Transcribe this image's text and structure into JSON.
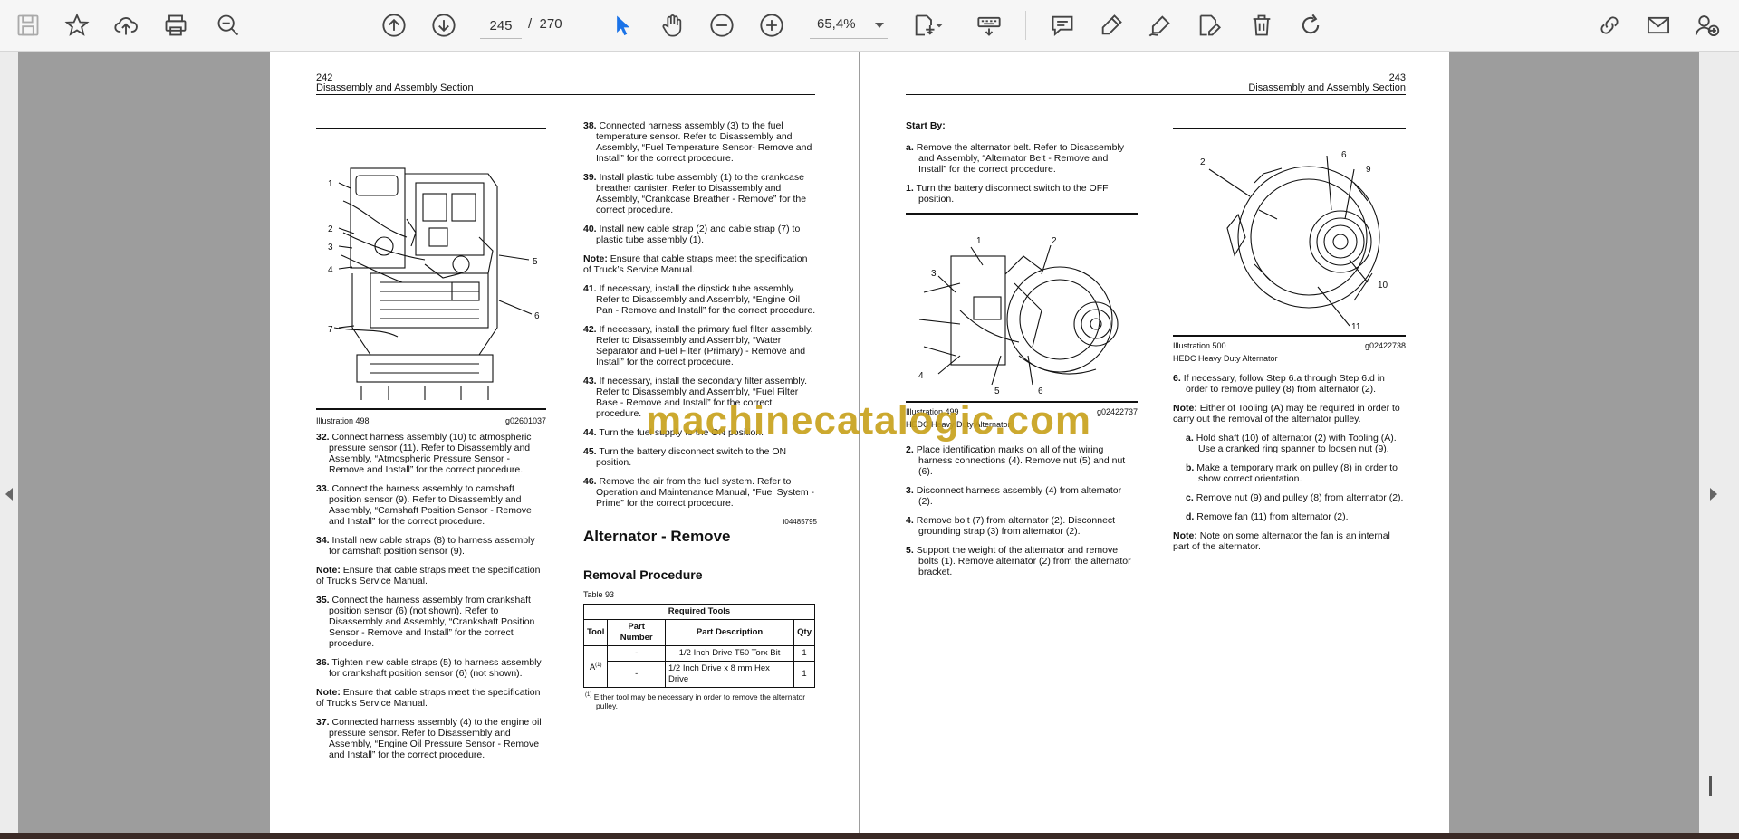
{
  "toolbar": {
    "page_current": "245",
    "page_separator": "/",
    "page_total": "270",
    "zoom": "65,4%"
  },
  "left_page": {
    "page_number": "242",
    "section": "Disassembly and Assembly Section",
    "illustration_label": "Illustration 498",
    "illustration_code": "g02601037",
    "callouts": [
      "1",
      "2",
      "3",
      "4",
      "5",
      "6",
      "7"
    ],
    "col1_steps": [
      {
        "num": "32.",
        "text": "Connect harness assembly (10) to atmospheric pressure sensor (11). Refer to Disassembly and Assembly, “Atmospheric Pressure Sensor - Remove and Install” for the correct procedure."
      },
      {
        "num": "33.",
        "text": "Connect the harness assembly to camshaft position sensor (9). Refer to Disassembly and Assembly, “Camshaft Position Sensor - Remove and Install” for the correct procedure."
      },
      {
        "num": "34.",
        "text": "Install new cable straps (8) to harness assembly for camshaft position sensor (9)."
      }
    ],
    "note1_label": "Note:",
    "note1_text": "Ensure that cable straps meet the specification of Truck’s Service Manual.",
    "col1_steps_b": [
      {
        "num": "35.",
        "text": "Connect the harness assembly from crankshaft position sensor (6) (not shown). Refer to Disassembly and Assembly, “Crankshaft Position Sensor - Remove and Install” for the correct procedure."
      },
      {
        "num": "36.",
        "text": "Tighten new cable straps (5) to harness assembly for crankshaft position sensor (6) (not shown)."
      }
    ],
    "note2_label": "Note:",
    "note2_text": "Ensure that cable straps meet the specification of Truck’s Service Manual.",
    "col1_steps_c": [
      {
        "num": "37.",
        "text": "Connected harness assembly (4) to the engine oil pressure sensor. Refer to Disassembly and Assembly, “Engine Oil Pressure Sensor - Remove and Install” for the correct procedure."
      }
    ],
    "col2_steps": [
      {
        "num": "38.",
        "text": "Connected harness assembly (3) to the fuel temperature sensor. Refer to Disassembly and Assembly, “Fuel Temperature Sensor- Remove and Install” for the correct procedure."
      },
      {
        "num": "39.",
        "text": "Install plastic tube assembly (1) to the crankcase breather canister. Refer to Disassembly and Assembly, “Crankcase Breather - Remove” for the correct procedure."
      },
      {
        "num": "40.",
        "text": "Install new cable strap (2) and cable strap (7) to plastic tube assembly (1)."
      }
    ],
    "note3_label": "Note:",
    "note3_text": "Ensure that cable straps meet the specification of Truck’s Service Manual.",
    "col2_steps_b": [
      {
        "num": "41.",
        "text": "If necessary, install the dipstick tube assembly. Refer to Disassembly and Assembly, “Engine Oil Pan - Remove and Install” for the correct procedure."
      },
      {
        "num": "42.",
        "text": "If necessary, install the primary fuel filter assembly. Refer to Disassembly and Assembly, “Water Separator and Fuel Filter (Primary) - Remove and Install” for the correct procedure."
      },
      {
        "num": "43.",
        "text": "If necessary, install the secondary filter assembly. Refer to Disassembly and Assembly, “Fuel Filter Base - Remove and Install” for the correct procedure."
      },
      {
        "num": "44.",
        "text": "Turn the fuel supply to the ON position."
      },
      {
        "num": "45.",
        "text": "Turn the battery disconnect switch to the ON position."
      },
      {
        "num": "46.",
        "text": "Remove the air from the fuel system. Refer to Operation and Maintenance Manual, “Fuel System - Prime” for the correct procedure."
      }
    ],
    "doc_code": "i04485795",
    "heading": "Alternator - Remove",
    "subheading": "Removal Procedure",
    "table_label": "Table 93",
    "table_title": "Required Tools",
    "table_headers": [
      "Tool",
      "Part Number",
      "Part Description",
      "Qty"
    ],
    "table_tool": "A",
    "table_tool_sup": "(1)",
    "table_rows": [
      {
        "part": "-",
        "desc": "1/2 Inch Drive T50 Torx Bit",
        "qty": "1"
      },
      {
        "part": "-",
        "desc": "1/2 Inch Drive x 8 mm Hex Drive",
        "qty": "1"
      }
    ],
    "footnote_mark": "(1)",
    "footnote_text": "Either tool may be necessary in order to remove the alternator pulley."
  },
  "right_page": {
    "page_number": "243",
    "section": "Disassembly and Assembly Section",
    "start_by": "Start By:",
    "start_steps": [
      {
        "num": "a.",
        "text": "Remove the alternator belt. Refer to Disassembly and Assembly, “Alternator Belt - Remove and Install” for the correct procedure."
      }
    ],
    "step1": {
      "num": "1.",
      "text": "Turn the battery disconnect switch to the OFF position."
    },
    "illus1_label": "Illustration 499",
    "illus1_code": "g02422737",
    "illus1_caption": "HEDC Heavy Duty Alternator",
    "illus1_callouts": [
      "1",
      "2",
      "3",
      "4",
      "5",
      "6"
    ],
    "steps": [
      {
        "num": "2.",
        "text": "Place identification marks on all of the wiring harness connections (4). Remove nut (5) and nut (6)."
      },
      {
        "num": "3.",
        "text": "Disconnect harness assembly (4) from alternator (2)."
      },
      {
        "num": "4.",
        "text": "Remove bolt (7) from alternator (2). Disconnect grounding strap (3) from alternator (2)."
      },
      {
        "num": "5.",
        "text": "Support the weight of the alternator and remove bolts (1). Remove alternator (2) from the alternator bracket."
      }
    ],
    "illus2_label": "Illustration 500",
    "illus2_code": "g02422738",
    "illus2_caption": "HEDC Heavy Duty Alternator",
    "illus2_callouts": [
      "2",
      "6",
      "9",
      "10",
      "11"
    ],
    "step6": {
      "num": "6.",
      "text": "If necessary, follow Step 6.a through Step 6.d in order to remove pulley (8) from alternator (2)."
    },
    "note1_label": "Note:",
    "note1_text": "Either of Tooling (A) may be required in order to carry out the removal of the alternator pulley.",
    "sub_steps": [
      {
        "num": "a.",
        "text": "Hold shaft (10) of alternator (2) with Tooling (A). Use a cranked ring spanner to loosen nut (9)."
      },
      {
        "num": "b.",
        "text": "Make a temporary mark on pulley (8) in order to show correct orientation."
      },
      {
        "num": "c.",
        "text": "Remove nut (9) and pulley (8) from alternator (2)."
      },
      {
        "num": "d.",
        "text": "Remove fan (11) from alternator (2)."
      }
    ],
    "note2_label": "Note:",
    "note2_text": "Note on some alternator the fan is an internal part of the alternator."
  },
  "watermark": "machinecatalogic.com"
}
